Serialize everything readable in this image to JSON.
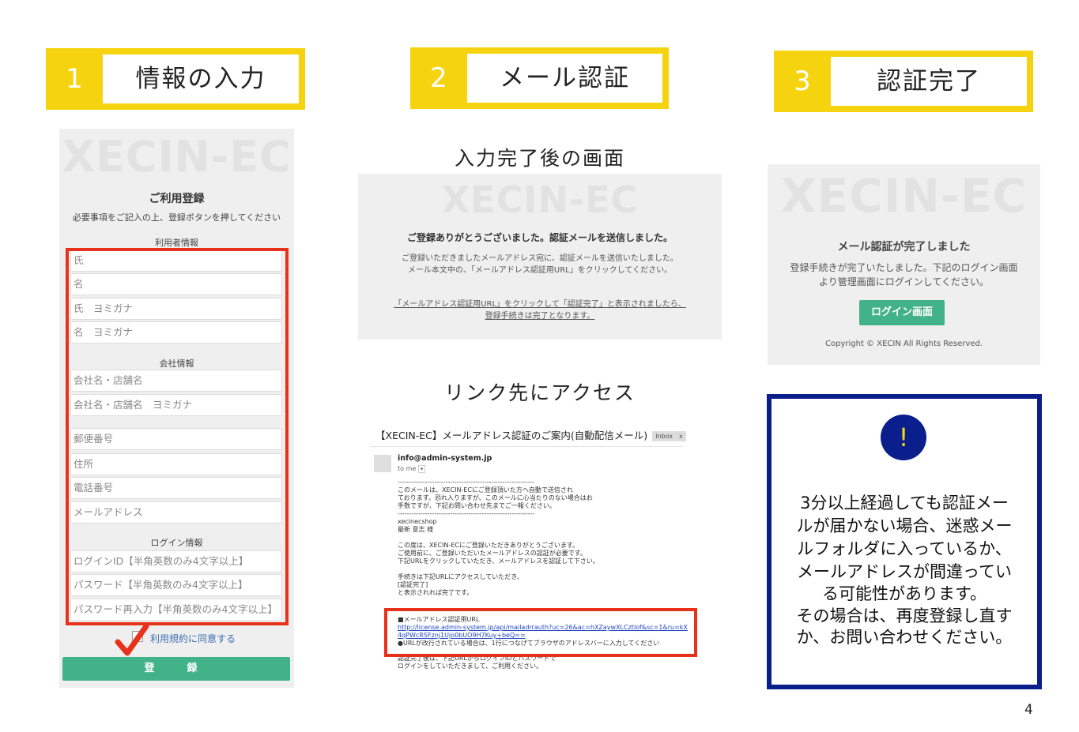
{
  "steps": [
    {
      "num": "1",
      "label": "情報の入力"
    },
    {
      "num": "2",
      "label": "メール認証"
    },
    {
      "num": "3",
      "label": "認証完了"
    }
  ],
  "watermark": "XECIN-EC",
  "form": {
    "title": "ご利用登録",
    "subtitle": "必要事項をご記入の上、登録ボタンを押してください",
    "section_user": "利用者情報",
    "section_company": "会社情報",
    "section_login": "ログイン情報",
    "fields_user": [
      "氏",
      "名",
      "氏　ヨミガナ",
      "名　ヨミガナ"
    ],
    "fields_company": [
      "会社名・店舗名",
      "会社名・店舗名　ヨミガナ",
      "郵便番号",
      "住所",
      "電話番号",
      "メールアドレス"
    ],
    "fields_login": [
      "ログインID【半角英数のみ4文字以上】",
      "パスワード【半角英数のみ4文字以上】",
      "パスワード再入力【半角英数のみ4文字以上】"
    ],
    "terms": "利用規約に同意する",
    "submit": "登　録"
  },
  "step2": {
    "caption_top": "入力完了後の画面",
    "heading": "ご登録ありがとうございました。認証メールを送信しました。",
    "body1": "ご登録いただきましたメールアドレス宛に、認証メールを送信いたしました。",
    "body2": "メール本文中の、「メールアドレス認証用URL」をクリックしてください。",
    "link1": "「メールアドレス認証用URL」をクリックして「認証完了」と表示されましたら、",
    "link2": "登録手続きは完了となります。",
    "caption_mid": "リンク先にアクセス"
  },
  "email": {
    "subject": "【XECIN-EC】メールアドレス認証のご案内(自動配信メール)",
    "badge": "Inbox　x",
    "from": "info@admin-system.jp",
    "to": "to me",
    "body": "------------------------------------------------------------\nこのメールは、XECIN-ECにご登録頂いた方へ自動で送信され\nております。恐れ入りますが、このメールに心当たりのない場合はお\n手数ですが、下記お問い合わせ先までご一報ください。\n------------------------------------------------------------\nxecinecshop\n最新 意志 様\n\nこの度は、XECIN-ECにご登録いただきありがとうございます。\nご使用前に、ご登録いただいたメールアドレスの認証が必要です。\n下記URLをクリックしていただき、メールアドレスを認証して下さい。\n\n手続きは下記URLにアクセスしていただき、\n[認証完了]\nと表示されれば完了です。",
    "url_label": "■メールアドレス認証用URL",
    "url": "http://license.admin-system.jp/api/mailadrrauth?uc=26&ac=hXZaywXLCztlof&sc=1&ru=kX4qPWcRSFznj1Ujo0bUO9H7Kuy+beQ==",
    "url_note": "●URLが改行されている場合は、1行につなげてブラウザのアドレスバーに入力してください",
    "tail": "認証完了後は、下記URLからログインIDとパスワードで\nログインをしていただきまして、ご利用ください。"
  },
  "step3": {
    "heading": "メール認証が完了しました",
    "body1": "登録手続きが完了いたしました。下記のログイン画面",
    "body2": "より管理画面にログインしてください。",
    "button": "ログイン画面",
    "copyright": "Copyright © XECIN All Rights Reserved."
  },
  "notice": {
    "icon": "!",
    "lines": [
      "3分以上経過しても認証メー",
      "ルが届かない場合、迷惑メー",
      "ルフォルダに入っているか、",
      "メールアドレスが間違ってい",
      "る可能性があります。",
      "その場合は、再度登録し直す",
      "か、お問い合わせください。"
    ]
  },
  "page_number": "4",
  "colors": {
    "accent_yellow": "#f5d40f",
    "highlight_red": "#e8311a",
    "button_green": "#42b288",
    "notice_navy": "#0a1f8c"
  }
}
